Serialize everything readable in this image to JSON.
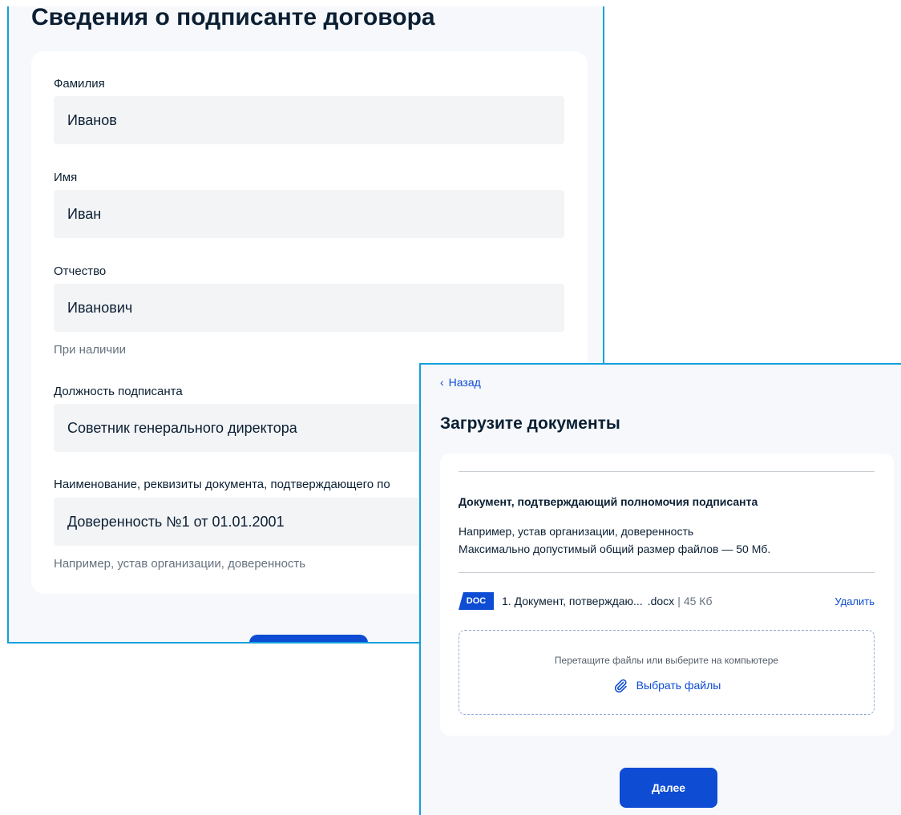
{
  "signer_form": {
    "title": "Сведения о подписанте договора",
    "fields": [
      {
        "label": "Фамилия",
        "value": "Иванов"
      },
      {
        "label": "Имя",
        "value": "Иван"
      },
      {
        "label": "Отчество",
        "value": "Иванович",
        "hint": "При наличии"
      },
      {
        "label": "Должность подписанта",
        "value": "Советник генерального директора"
      },
      {
        "label": "Наименование, реквизиты документа, подтверждающего по",
        "value": "Доверенность №1 от 01.01.2001",
        "hint": "Например, устав организации, доверенность"
      }
    ]
  },
  "upload": {
    "back_label": "Назад",
    "title": "Загрузите документы",
    "doc_title": "Документ, подтверждающий полномочия подписанта",
    "doc_desc_1": "Например, устав организации, доверенность",
    "doc_desc_2": "Максимально допустимый общий размер файлов — 50 Мб.",
    "file": {
      "badge": "DOC",
      "name": "1. Документ, потверждаю...",
      "ext": ".docx",
      "separator": "|",
      "size": "45 Кб",
      "delete_label": "Удалить"
    },
    "dropzone_text": "Перетащите файлы или выберите на компьютере",
    "choose_label": "Выбрать файлы",
    "next_label": "Далее"
  },
  "colors": {
    "primary": "#0d4cd3",
    "frame": "#14a0dc",
    "text": "#0b1f33",
    "muted": "#66727f"
  }
}
